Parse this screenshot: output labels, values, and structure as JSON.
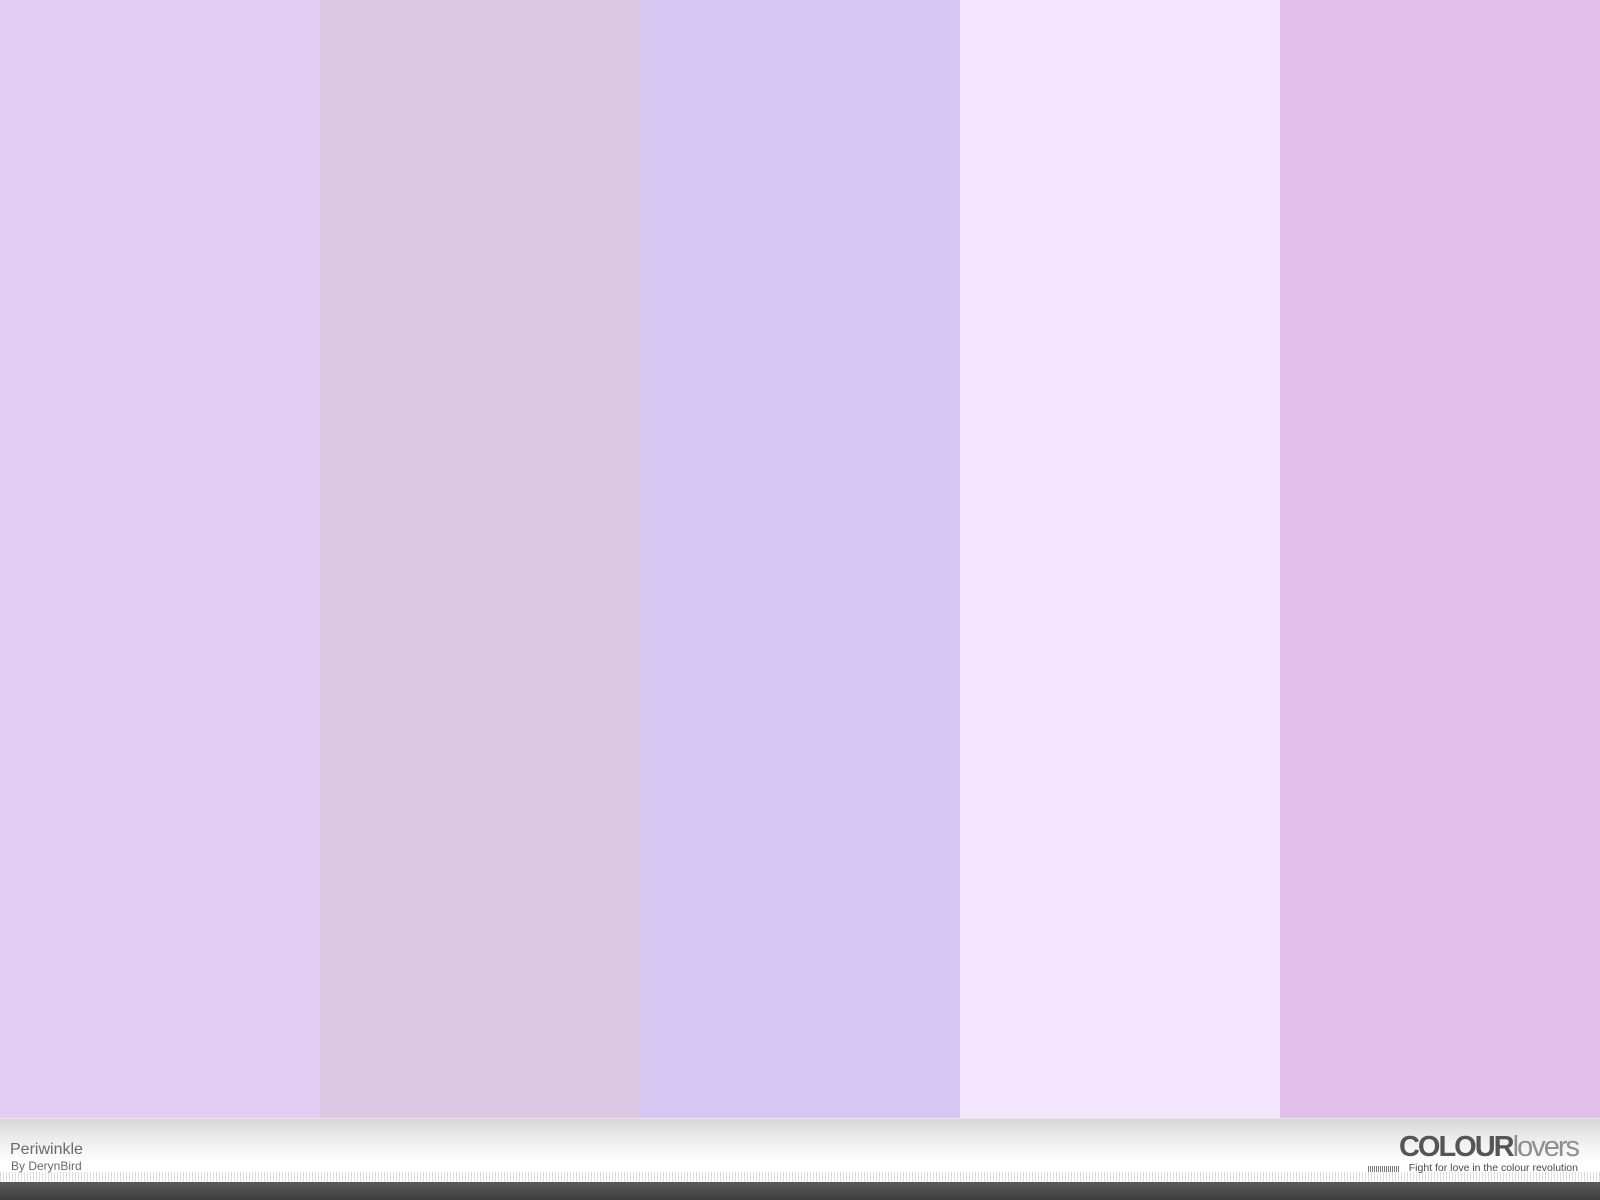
{
  "palette": {
    "title": "Periwinkle",
    "author": "By DerynBird",
    "swatches": [
      {
        "name": "swatch-1",
        "color": "#E4CEF4"
      },
      {
        "name": "swatch-2",
        "color": "#DCC8E2"
      },
      {
        "name": "swatch-3",
        "color": "#D6C6F2"
      },
      {
        "name": "swatch-4",
        "color": "#F4E6FC"
      },
      {
        "name": "swatch-5",
        "color": "#E3BFEC"
      }
    ]
  },
  "brand": {
    "wordmark_bold": "COLOUR",
    "wordmark_light": "lovers",
    "tagline": "Fight for love in the colour revolution",
    "colors": {
      "bold": "#555555",
      "light": "#8F8F8F"
    }
  }
}
